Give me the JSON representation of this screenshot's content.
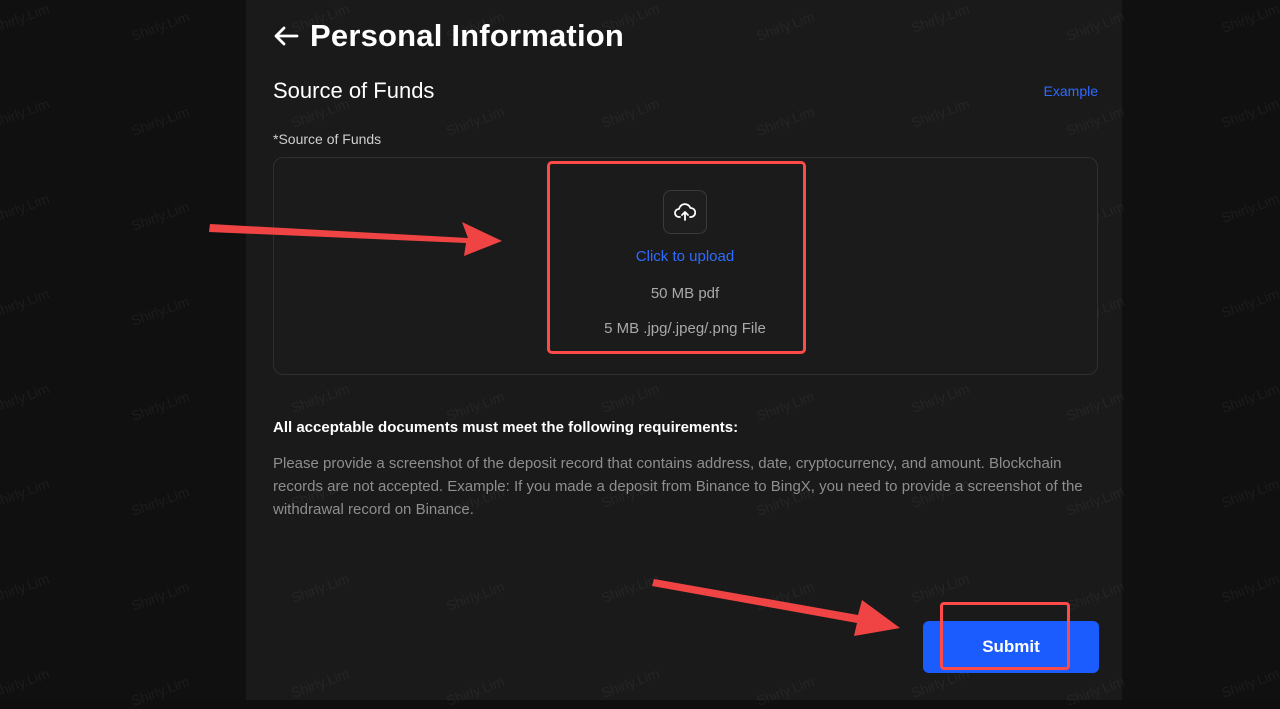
{
  "page": {
    "title": "Personal Information",
    "back_icon": "arrow-left-icon"
  },
  "section": {
    "title": "Source of Funds",
    "example_link": "Example",
    "field_label": "*Source of Funds"
  },
  "upload": {
    "icon": "cloud-upload-icon",
    "cta": "Click to upload",
    "pdf_limit": "50 MB pdf",
    "image_limit": "5 MB .jpg/.jpeg/.png File"
  },
  "requirements": {
    "title": "All acceptable documents must meet the following requirements:",
    "body": "Please provide a screenshot of the deposit record that contains address, date, cryptocurrency, and amount. Blockchain records are not accepted. Example: If you made a deposit from Binance to BingX, you need to provide a screenshot of the withdrawal record on Binance."
  },
  "actions": {
    "submit_label": "Submit"
  },
  "watermark": "Shirly.Lim",
  "colors": {
    "accent": "#1b5cff",
    "link": "#2f6bff",
    "annotation": "#ff4a4a",
    "panel_bg": "#1a1a1a"
  }
}
